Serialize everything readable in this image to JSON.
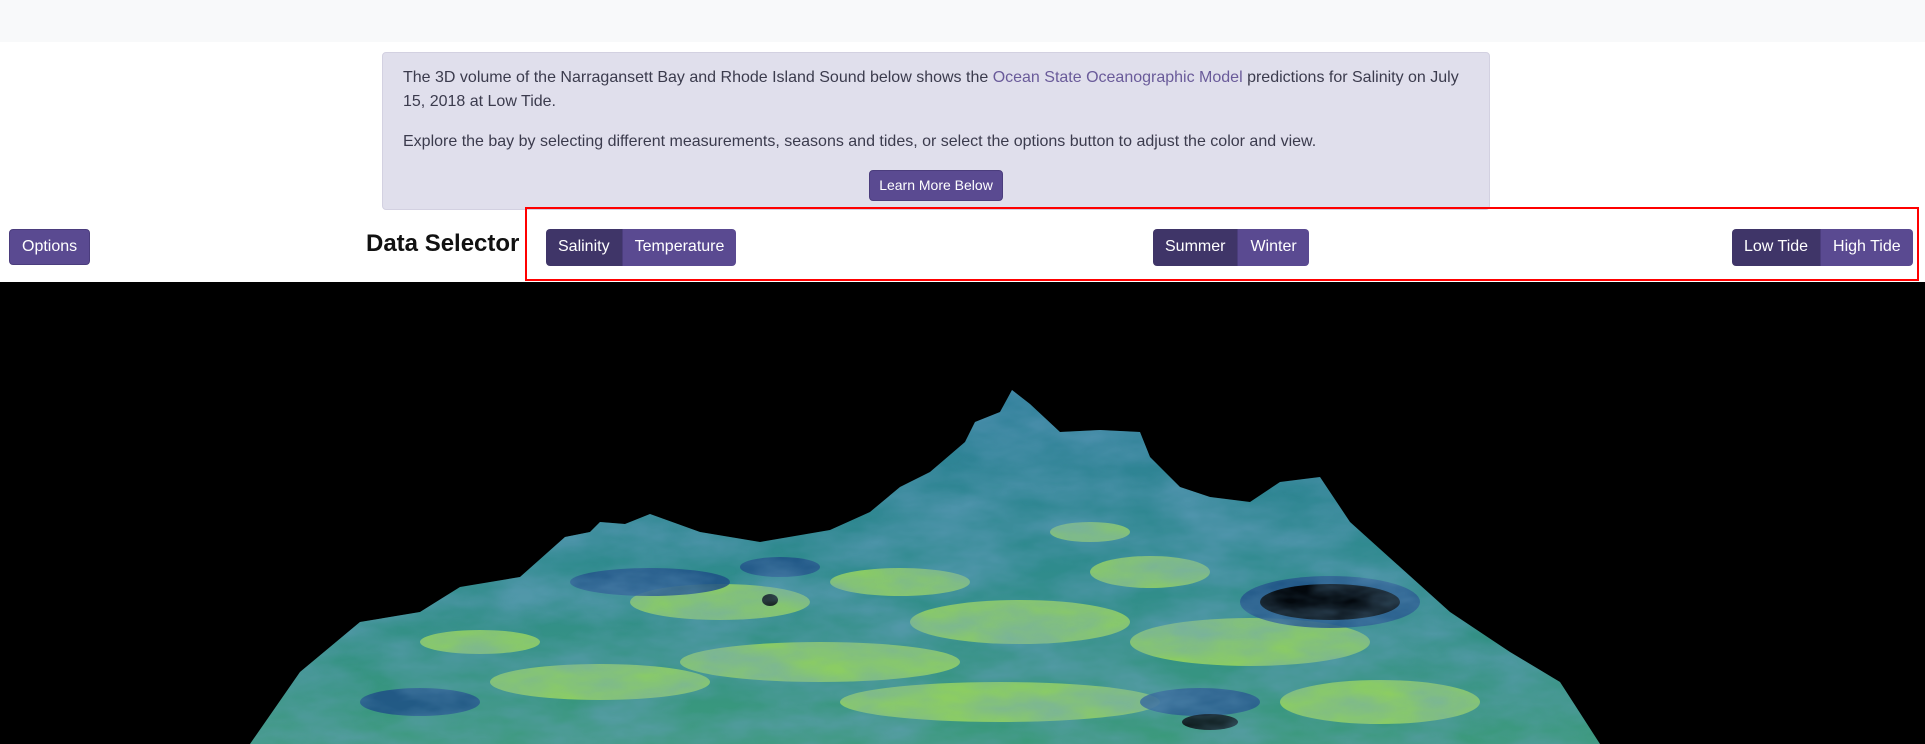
{
  "info": {
    "text_before": "The 3D volume of the Narragansett Bay and Rhode Island Sound below shows the ",
    "link_text": "Ocean State Oceanographic Model",
    "text_after": " predictions for Salinity on July 15, 2018 at Low Tide.",
    "explore_text": "Explore the bay by selecting different measurements, seasons and tides, or select the options button to adjust the color and view.",
    "learn_more_label": "Learn More Below"
  },
  "options_label": "Options",
  "data_selector": {
    "title": "Data Selector",
    "measurement": {
      "options": [
        "Salinity",
        "Temperature"
      ],
      "selected": "Salinity"
    },
    "season": {
      "options": [
        "Summer",
        "Winter"
      ],
      "selected": "Summer"
    },
    "tide": {
      "options": [
        "Low Tide",
        "High Tide"
      ],
      "selected": "Low Tide"
    }
  },
  "colors": {
    "accent": "#5a4a91",
    "accent_active": "#3f3568",
    "info_bg": "#e0dfec",
    "link": "#6a5b9a",
    "highlight_border": "#ff0000",
    "viewer_bg": "#000000",
    "volume_low": "#1f4f86",
    "volume_mid": "#2f8b8d",
    "volume_high": "#a8e05a"
  }
}
